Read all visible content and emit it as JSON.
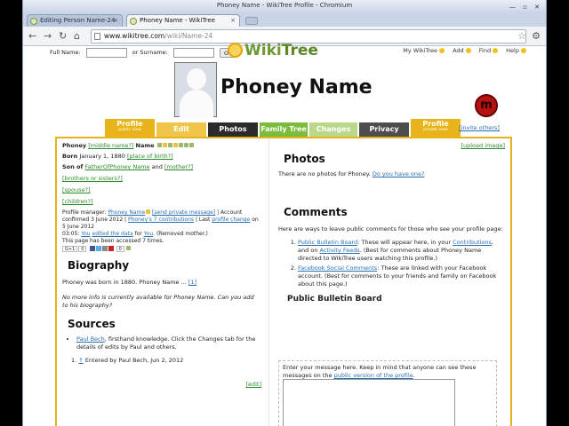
{
  "browser": {
    "window_title": "Phoney Name - WikiTree Profile - Chromium",
    "tabs": [
      {
        "title": "Editing Person Name-24",
        "active": false
      },
      {
        "title": "Phoney Name - WikiTree",
        "active": true
      }
    ],
    "url_host": "www.wikitree.com",
    "url_path": "/wiki/Name-24"
  },
  "header": {
    "fullname_label": "Full Name:",
    "surname_label": "or Surname:",
    "go_label": "Go",
    "logo_wiki": "Wiki",
    "logo_tree": "Tree",
    "nav": [
      "My WikiTree",
      "Add",
      "Find",
      "Help"
    ]
  },
  "profile": {
    "name": "Phoney Name",
    "tabs": [
      {
        "label": "Profile",
        "sub": "public view",
        "color": "#e8b41a"
      },
      {
        "label": "Edit",
        "sub": "",
        "color": "#f0c64a"
      },
      {
        "label": "Photos",
        "sub": "",
        "color": "#2b2b2b"
      },
      {
        "label": "Family Tree",
        "sub": "",
        "color": "#7dbb3c"
      },
      {
        "label": "Changes",
        "sub": "",
        "color": "#b9d88a"
      },
      {
        "label": "Privacy",
        "sub": "",
        "color": "#4d4d4d"
      },
      {
        "label": "Profile",
        "sub": "private view",
        "color": "#e8b41a"
      }
    ],
    "invite": "[invite others]",
    "upload_image": "[upload image]"
  },
  "vitals": {
    "first": "Phoney",
    "middle_link": "[middle name?]",
    "last": "Name",
    "born_label": "Born",
    "born_date": "January 1, 1880",
    "birth_place_link": "[place of birth?]",
    "son_of_label": "Son of",
    "father_link": "FatherOfPhoney Name",
    "and_text": "and",
    "mother_link": "[mother?]",
    "siblings_link": "[brothers or sisters?]",
    "spouse_link": "[spouse?]",
    "children_link": "[children?]"
  },
  "manager": {
    "label": "Profile manager:",
    "name": "Phoney Name",
    "send_pm": "[send private message]",
    "confirmed": "| Account confirmed 3 June 2012 |",
    "contributions": "Phoney's 7 contributions",
    "last_change_prefix": "| Last",
    "last_change_link": "profile change",
    "last_change_date": "on 5 June 2012",
    "edit_time": "03:05:",
    "edit_you": "You",
    "edit_text": "edited the data",
    "edit_for": "for",
    "edit_target": "You",
    "edit_note": ". (Removed mother.)",
    "accessed": "This page has been accessed 7 times.",
    "share_label": "0",
    "like_count": "0"
  },
  "biography": {
    "title": "Biography",
    "text": "Phoney was born in 1880. Phoney Name ...",
    "ref": "[1]",
    "more_info": "No more info is currently available for Phoney Name. Can you add to his biography?"
  },
  "sources": {
    "title": "Sources",
    "item_link": "Paul Bech",
    "item_text": ", firsthand knowledge. Click the Changes tab for the details of edits by Paul and others.",
    "footnote_mark": "↑",
    "footnote_text": "Entered by Paul Bech, Jun 2, 2012",
    "edit_link": "[edit]"
  },
  "photos": {
    "title": "Photos",
    "text": "There are no photos for Phoney.",
    "link": "Do you have one?"
  },
  "comments": {
    "title": "Comments",
    "intro": "Here are ways to leave public comments for those who see your profile page:",
    "item1_link": "Public Bulletin Board",
    "item1_a": ": These will appear here, in your",
    "item1_contrib": "Contributions",
    "item1_b": ", and on",
    "item1_feeds": "Activity Feeds",
    "item1_c": ". (Best for comments about Phoney Name directed to WikiTree users watching this profile.)",
    "item2_link": "Facebook Social Comments",
    "item2_text": ": These are linked with your Facebook account. (Best for comments to your friends and family on Facebook about this page.)"
  },
  "bulletin": {
    "title": "Public Bulletin Board",
    "prompt": "Enter your message here. Keep in mind that anyone can see these messages on the",
    "prompt_link": "public version of the profile",
    "prompt_end": "."
  }
}
